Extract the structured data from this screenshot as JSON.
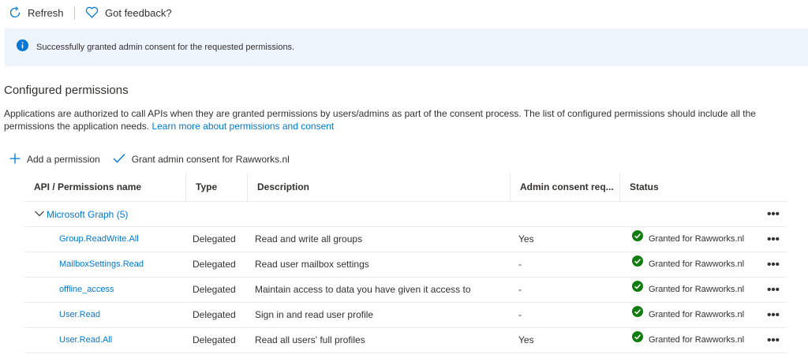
{
  "toolbar": {
    "refresh_label": "Refresh",
    "feedback_label": "Got feedback?"
  },
  "banner": {
    "message": "Successfully granted admin consent for the requested permissions."
  },
  "section": {
    "title": "Configured permissions",
    "description": "Applications are authorized to call APIs when they are granted permissions by users/admins as part of the consent process. The list of configured permissions should include all the permissions the application needs.",
    "learn_more_link": "Learn more about permissions and consent"
  },
  "actions": {
    "add_permission_label": "Add a permission",
    "grant_consent_label": "Grant admin consent for Rawworks.nl"
  },
  "table": {
    "columns": [
      "API / Permissions name",
      "Type",
      "Description",
      "Admin consent req...",
      "Status"
    ],
    "group": {
      "label": "Microsoft Graph (5)"
    },
    "more_glyph": "•••",
    "rows": [
      {
        "api": "Group.ReadWrite.All",
        "type": "Delegated",
        "description": "Read and write all groups",
        "admin": "Yes",
        "status": "Granted for Rawworks.nl"
      },
      {
        "api": "MailboxSettings.Read",
        "type": "Delegated",
        "description": "Read user mailbox settings",
        "admin": "-",
        "status": "Granted for Rawworks.nl"
      },
      {
        "api": "offline_access",
        "type": "Delegated",
        "description": "Maintain access to data you have given it access to",
        "admin": "-",
        "status": "Granted for Rawworks.nl"
      },
      {
        "api": "User.Read",
        "type": "Delegated",
        "description": "Sign in and read user profile",
        "admin": "-",
        "status": "Granted for Rawworks.nl"
      },
      {
        "api": "User.Read.All",
        "type": "Delegated",
        "description": "Read all users' full profiles",
        "admin": "Yes",
        "status": "Granted for Rawworks.nl"
      }
    ]
  },
  "colors": {
    "accent": "#0078d4",
    "success": "#107c10",
    "banner_bg": "#eef4fb"
  },
  "icons": {
    "refresh": "refresh-icon",
    "feedback": "heart-icon",
    "info": "info-icon",
    "add": "plus-icon",
    "grant": "checkmark-icon",
    "status": "check-circle-icon",
    "expand": "chevron-down-icon",
    "more": "more-icon"
  }
}
